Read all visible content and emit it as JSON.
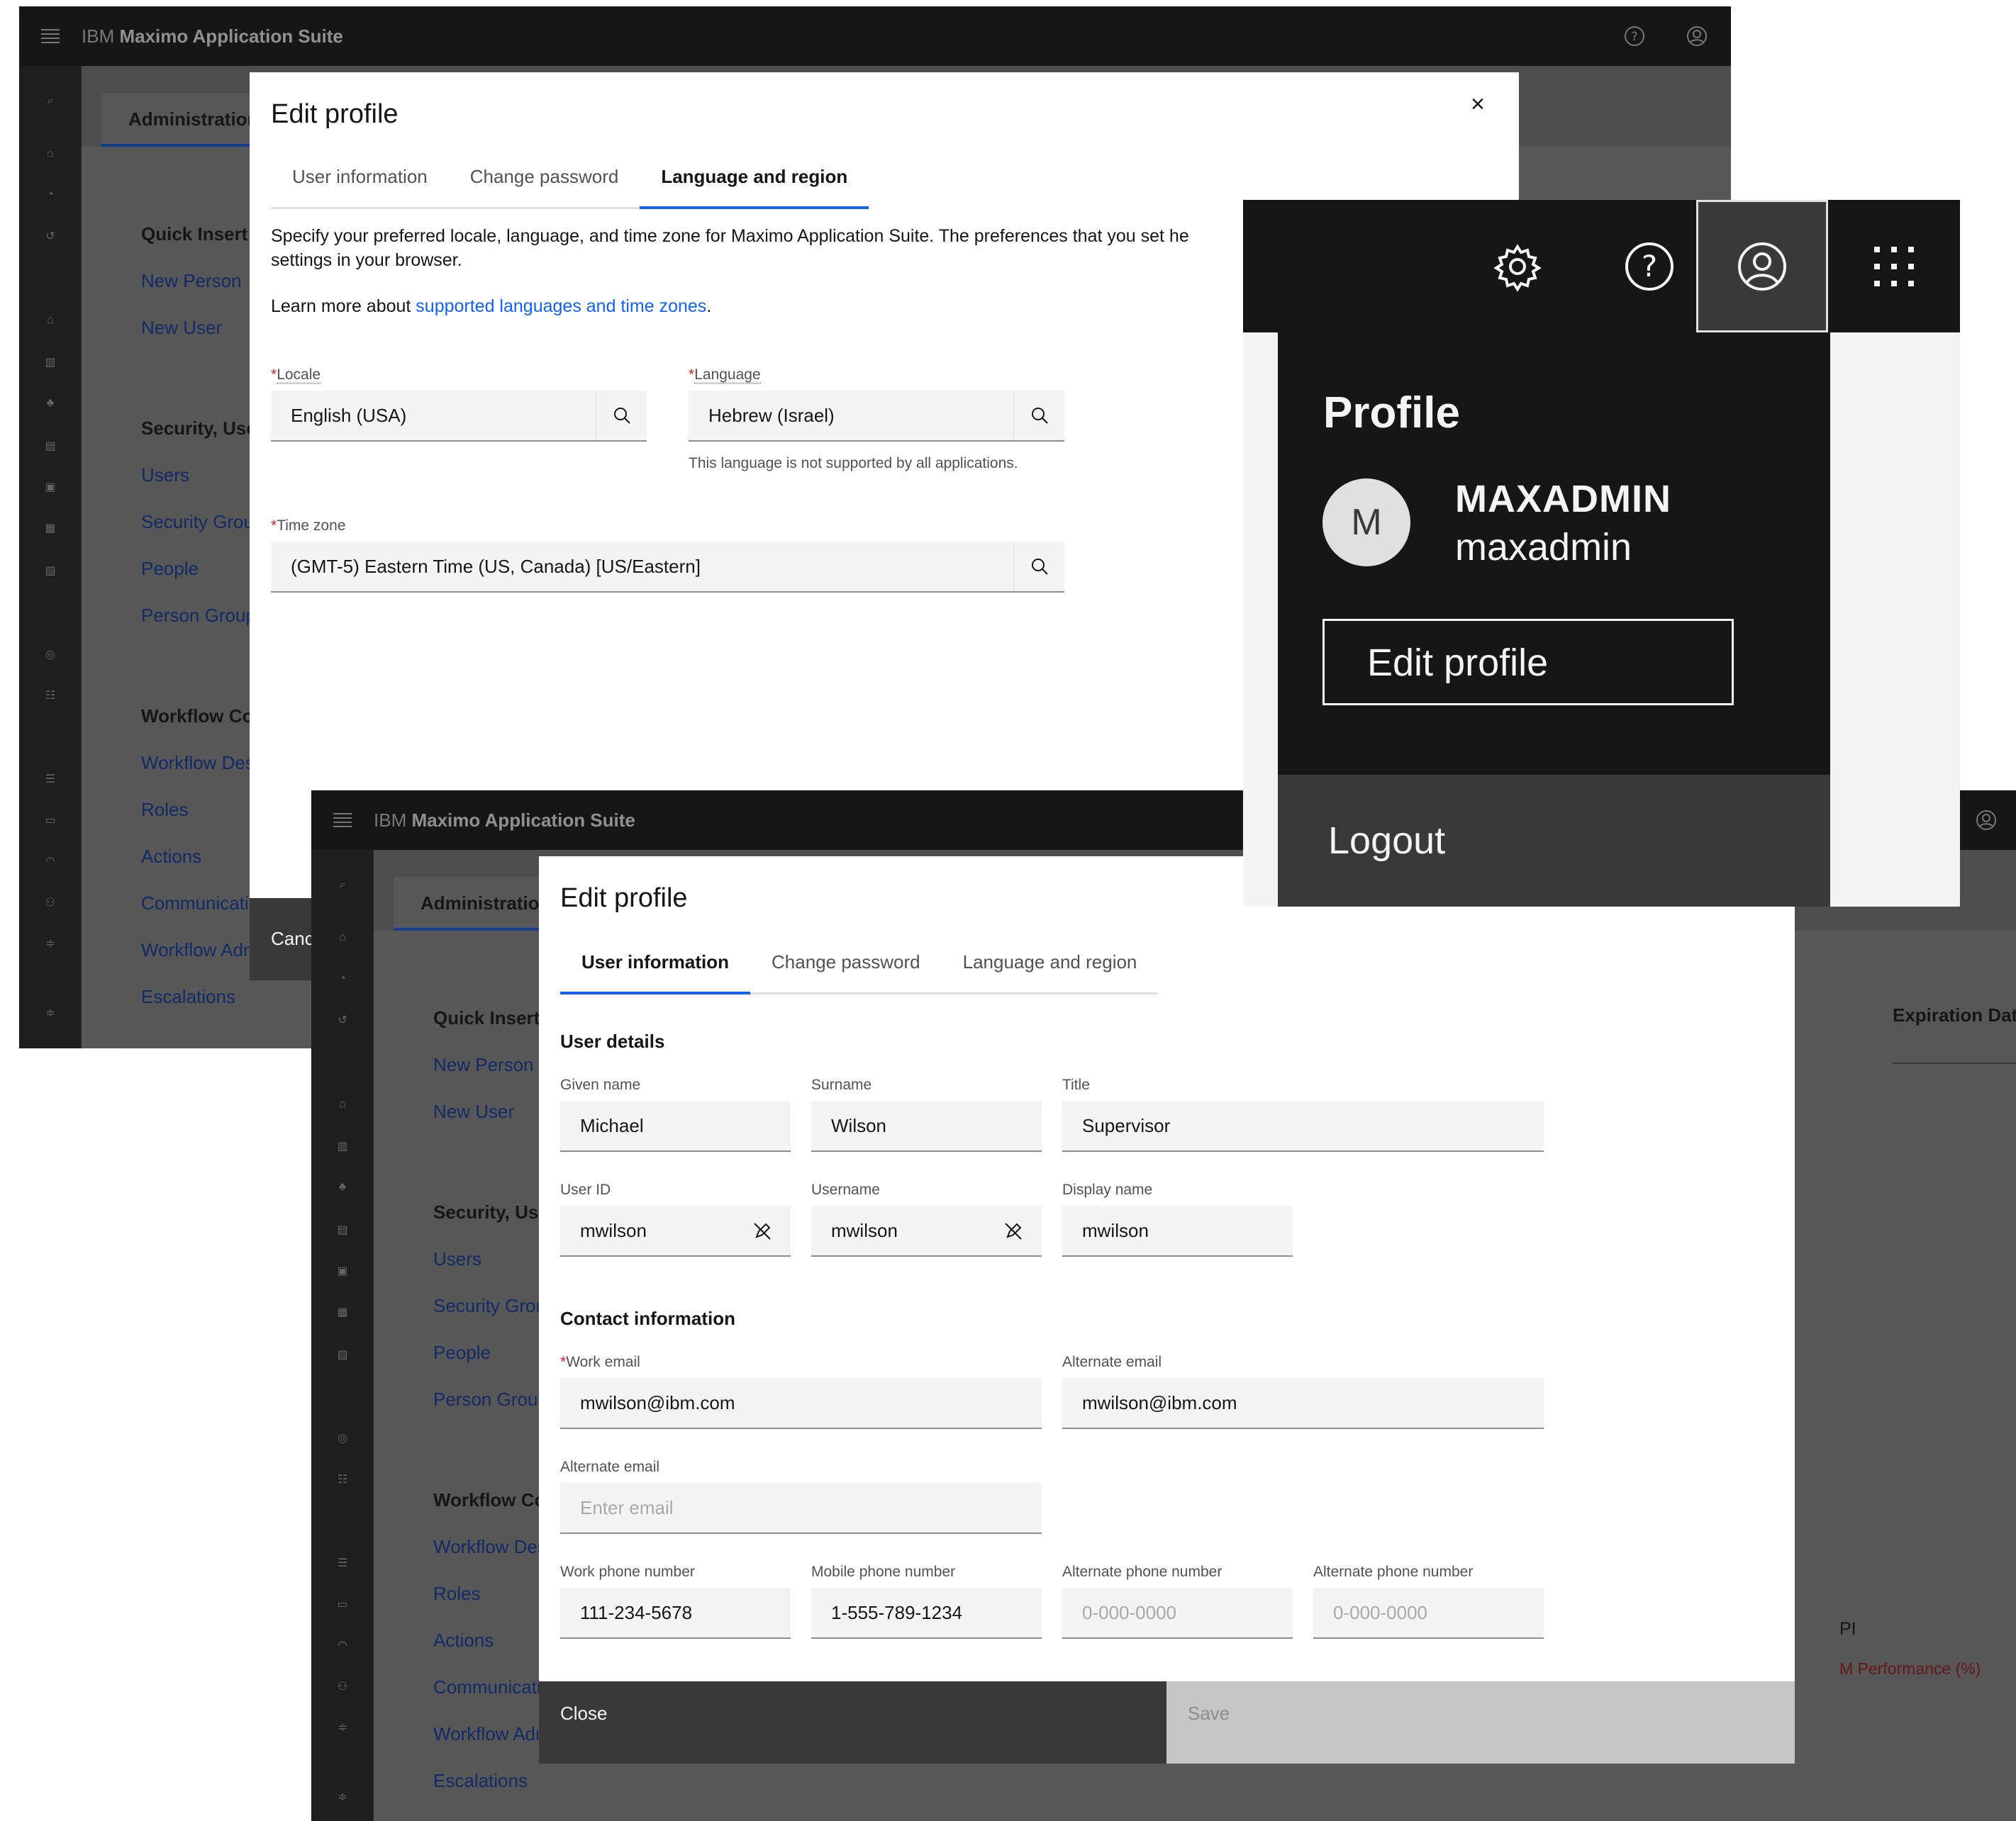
{
  "app": {
    "brand_prefix": "IBM",
    "brand_name": "Maximo Application Suite"
  },
  "background": {
    "admin_tab": "Administration",
    "expiration_header": "Expiration Date",
    "kpi_text": "PI",
    "performance_text": "M Performance (%)",
    "cancel_peek": "Canc",
    "cards": [
      {
        "title": "Quick Insert",
        "links": [
          "New Person",
          "New User"
        ]
      },
      {
        "title": "Security, Users",
        "links": [
          "Users",
          "Security Groups",
          "People",
          "Person Groups"
        ]
      },
      {
        "title": "Workflow Configuration",
        "links": [
          "Workflow Designer",
          "Roles",
          "Actions",
          "Communication Templates",
          "Workflow Administration",
          "Escalations"
        ]
      }
    ]
  },
  "modal_a": {
    "title": "Edit profile",
    "close_glyph": "×",
    "tabs": [
      "User information",
      "Change password",
      "Language and region"
    ],
    "active_tab": 2,
    "intro": "Specify your preferred locale, language, and time zone for Maximo Application Suite. The preferences that you set he",
    "intro_line2": "settings in your browser.",
    "learn_prefix": "Learn more about ",
    "learn_link": "supported languages and time zones",
    "learn_suffix": ".",
    "locale_label": "Locale",
    "locale_value": "English (USA)",
    "language_label": "Language",
    "language_value": "Hebrew (Israel)",
    "language_helper": "This language is not supported by all applications.",
    "timezone_label": "Time zone",
    "timezone_value": "(GMT-5) Eastern Time (US, Canada) [US/Eastern]",
    "required_mark": "*"
  },
  "profile_popup": {
    "heading": "Profile",
    "avatar_initial": "M",
    "display_name": "MAXADMIN",
    "username": "maxadmin",
    "edit_button": "Edit profile",
    "logout": "Logout"
  },
  "modal_b": {
    "title": "Edit profile",
    "tabs": [
      "User information",
      "Change password",
      "Language and region"
    ],
    "active_tab": 0,
    "user_details_heading": "User details",
    "given_name_label": "Given name",
    "given_name": "Michael",
    "surname_label": "Surname",
    "surname": "Wilson",
    "title_label": "Title",
    "title_value": "Supervisor",
    "user_id_label": "User ID",
    "user_id": "mwilson",
    "username_label": "Username",
    "username": "mwilson",
    "display_name_label": "Display name",
    "display_name": "mwilson",
    "contact_heading": "Contact information",
    "work_email_label": "Work email",
    "work_email": "mwilson@ibm.com",
    "alt_email_label": "Alternate email",
    "alt_email": "mwilson@ibm.com",
    "alt_email2_label": "Alternate email",
    "alt_email2_placeholder": "Enter email",
    "work_phone_label": "Work phone number",
    "work_phone": "111-234-5678",
    "mobile_phone_label": "Mobile phone number",
    "mobile_phone": "1-555-789-1234",
    "alt_phone1_label": "Alternate phone number",
    "alt_phone1_placeholder": "0-000-0000",
    "alt_phone2_label": "Alternate phone number",
    "alt_phone2_placeholder": "0-000-0000",
    "close_button": "Close",
    "save_button": "Save",
    "required_mark": "*"
  },
  "colors": {
    "accent": "#0f62fe",
    "shell": "#161616",
    "required": "#da1e28",
    "error_text": "#da1e28"
  }
}
